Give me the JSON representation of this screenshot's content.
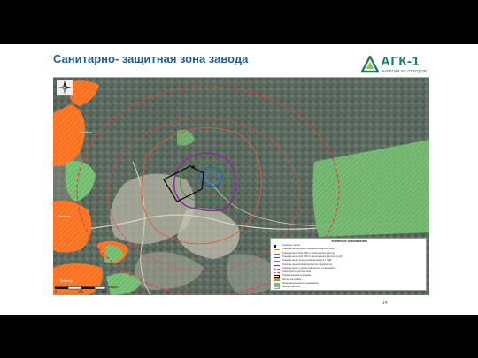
{
  "slide": {
    "title": "Санитарно- защитная зона завода",
    "page_number": "14"
  },
  "logo": {
    "name": "АГК-1",
    "tagline": "ЭНЕРГИЯ ИЗ ОТХОДОВ",
    "icon": "recycle-triangle-icon",
    "color": "#1a7a6c"
  },
  "map": {
    "compass_icon": "north-arrow-icon",
    "scale_unit": "Метры",
    "scale_ticks": [
      "0",
      "250",
      "500"
    ],
    "place_labels": [
      "Посёлок",
      "Посёлок",
      "Посёлок"
    ],
    "legend": {
      "title": "Условные обозначения",
      "items": [
        {
          "label": "Граница участка",
          "color": "#111111",
          "style": "dot"
        },
        {
          "label": "Граница нормативной санитарно-защитной зоны",
          "color": "#e09020",
          "style": "line"
        },
        {
          "label": "Граница расчётной СЗЗ по химическому фактору",
          "color": "#2a9a3a",
          "style": "line"
        },
        {
          "label": "Граница расчётной СЗЗ по физическому фактору (шум)",
          "color": "#1a5fd0",
          "style": "line"
        },
        {
          "label": "Граница зоны с концентрацией выше 0,1 ПДК",
          "color": "#20a0c0",
          "style": "line"
        },
        {
          "label": "Граница зоны влияния выбросов предприятия",
          "color": "#8a2aa0",
          "style": "line"
        },
        {
          "label": "Граница зоны с учётом розы ветров и ландшафта",
          "color": "#c83030",
          "style": "dash"
        },
        {
          "label": "Санитарно-защитная зона",
          "color": "#e04040",
          "style": "dash"
        },
        {
          "label": "Промышленная площадка",
          "color": "#111111",
          "style": "outline"
        },
        {
          "label": "Жилая застройка",
          "color": "#ff7a2a",
          "style": "fill"
        },
        {
          "label": "Зона рекреационного назначения",
          "color": "#6cc46c",
          "style": "fill"
        },
        {
          "label": "Лесные массивы",
          "color": "#ffffff",
          "style": "outline"
        }
      ]
    },
    "colors": {
      "forest_dark": "#4a5a50",
      "forest_mid": "#6b7a6e",
      "clearing": "#c8c4b0",
      "residential": "#ff7a2a",
      "recreation": "#7cc478",
      "sanitary_zone": "#e04040",
      "influence_zone": "#8a2aa0"
    }
  }
}
